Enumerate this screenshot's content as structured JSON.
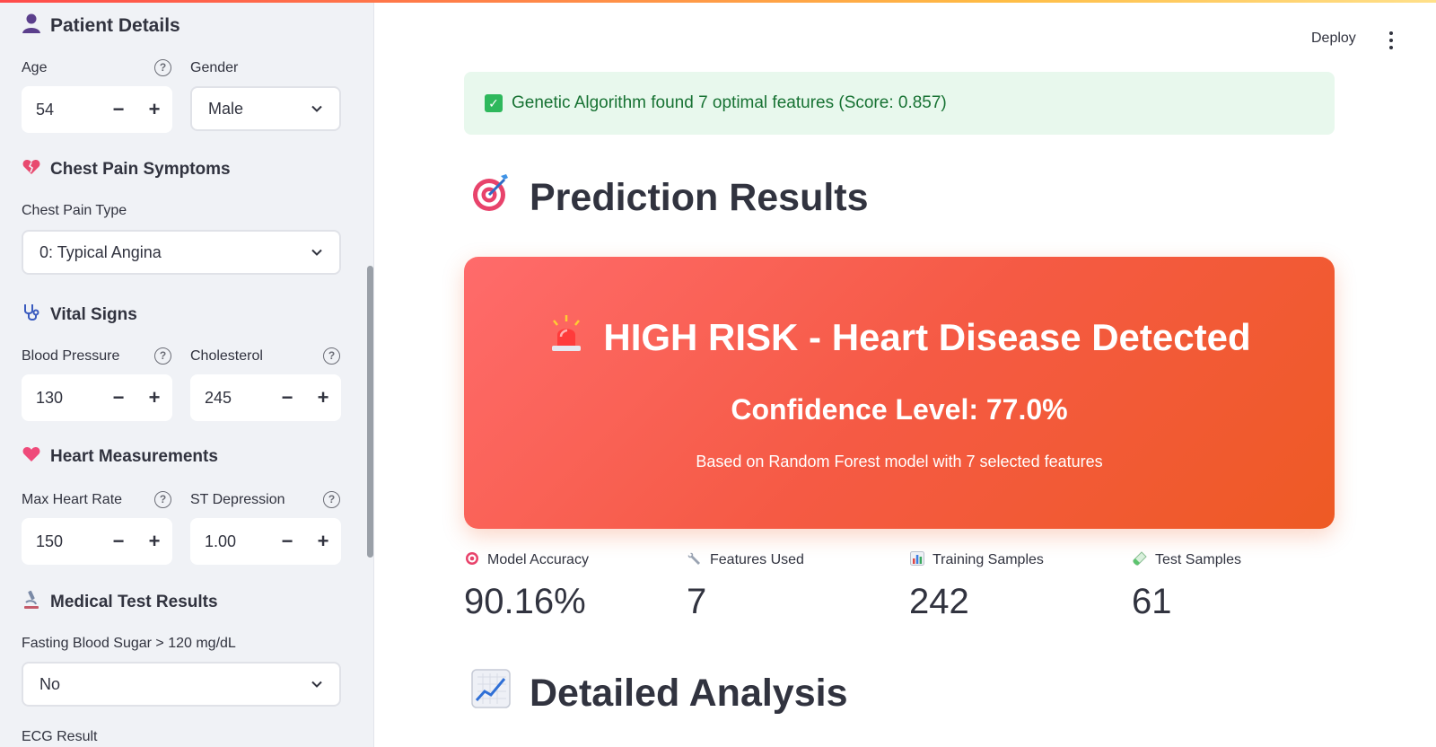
{
  "sidebar": {
    "patient_details": {
      "icon": "person-icon",
      "title": "Patient Details"
    },
    "age": {
      "label": "Age",
      "value": "54",
      "help": "?"
    },
    "gender": {
      "label": "Gender",
      "value": "Male"
    },
    "chest_pain": {
      "icon": "broken-heart-icon",
      "title": "Chest Pain Symptoms",
      "type_label": "Chest Pain Type",
      "type_value": "0: Typical Angina"
    },
    "vital_signs": {
      "icon": "stethoscope-icon",
      "title": "Vital Signs"
    },
    "blood_pressure": {
      "label": "Blood Pressure",
      "value": "130",
      "help": "?"
    },
    "cholesterol": {
      "label": "Cholesterol",
      "value": "245",
      "help": "?"
    },
    "heart_measurements": {
      "icon": "heart-icon",
      "title": "Heart Measurements"
    },
    "max_heart_rate": {
      "label": "Max Heart Rate",
      "value": "150",
      "help": "?"
    },
    "st_depression": {
      "label": "ST Depression",
      "value": "1.00",
      "help": "?"
    },
    "medical_tests": {
      "icon": "microscope-icon",
      "title": "Medical Test Results"
    },
    "fasting_blood_sugar": {
      "label": "Fasting Blood Sugar > 120 mg/dL",
      "value": "No"
    },
    "ecg": {
      "label": "ECG Result"
    },
    "minus": "−",
    "plus": "+"
  },
  "header": {
    "deploy": "Deploy"
  },
  "success_message": "Genetic Algorithm found 7 optimal features (Score: 0.857)",
  "prediction": {
    "heading": "Prediction Results",
    "heading_icon": "target-icon",
    "risk_icon": "siren-icon",
    "title": "HIGH RISK - Heart Disease Detected",
    "confidence": "Confidence Level: 77.0%",
    "subtitle": "Based on Random Forest model with 7 selected features",
    "card_gradient": [
      "#ff6b6b",
      "#ee5a24"
    ]
  },
  "metrics": [
    {
      "icon": "target-icon",
      "label": "Model Accuracy",
      "value": "90.16%"
    },
    {
      "icon": "wrench-icon",
      "label": "Features Used",
      "value": "7"
    },
    {
      "icon": "bar-chart-icon",
      "label": "Training Samples",
      "value": "242"
    },
    {
      "icon": "test-tube-icon",
      "label": "Test Samples",
      "value": "61"
    }
  ],
  "analysis": {
    "heading": "Detailed Analysis",
    "heading_icon": "line-chart-icon"
  }
}
